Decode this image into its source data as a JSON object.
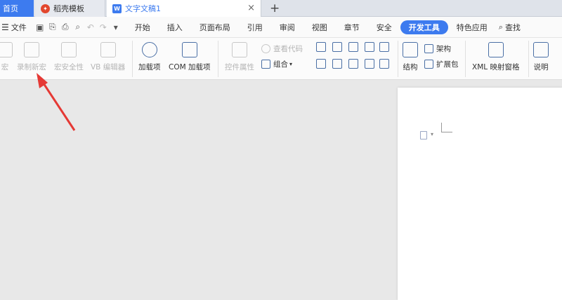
{
  "tabs": {
    "home": "首页",
    "daoke": "稻壳模板",
    "doc": "文字文稿1",
    "close": "×",
    "plus": "+"
  },
  "menubar": {
    "file": "文件",
    "items": [
      "开始",
      "插入",
      "页面布局",
      "引用",
      "审阅",
      "视图",
      "章节",
      "安全",
      "开发工具",
      "特色应用"
    ],
    "active_item": "开发工具",
    "search": "查找"
  },
  "ribbon": {
    "macro": "宏",
    "record_macro": "录制新宏",
    "macro_security": "宏安全性",
    "vb_editor": "VB 编辑器",
    "addins": "加载项",
    "com_addins": "COM 加载项",
    "control_props": "控件属性",
    "view_code": "查看代码",
    "group": "组合",
    "structure": "结构",
    "schema": "架构",
    "expansion_pack": "扩展包",
    "xml_mapping": "XML 映射窗格",
    "help": "说明"
  },
  "colors": {
    "accent": "#3d7bef",
    "arrow": "#e53935"
  }
}
